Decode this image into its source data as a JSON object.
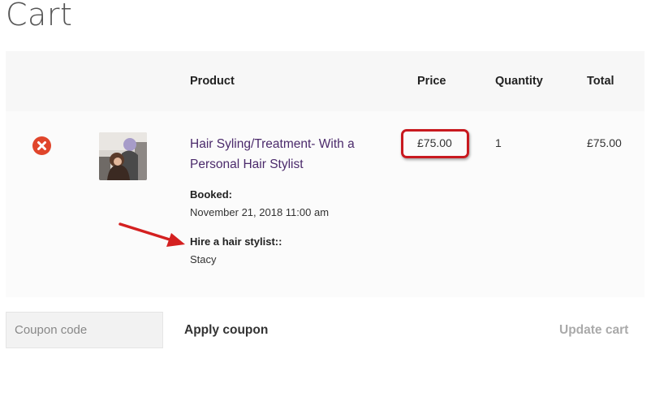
{
  "page": {
    "title": "Cart"
  },
  "table": {
    "headers": {
      "product": "Product",
      "price": "Price",
      "quantity": "Quantity",
      "total": "Total"
    },
    "rows": [
      {
        "product_name": "Hair Syling/Treatment- With a Personal Hair Stylist",
        "booked_label": "Booked:",
        "booked_value": "November 21, 2018 11:00 am",
        "stylist_label": "Hire a hair stylist::",
        "stylist_value": "Stacy",
        "price": "£75.00",
        "quantity": "1",
        "total": "£75.00",
        "remove_icon": "close-icon"
      }
    ]
  },
  "coupon": {
    "placeholder": "Coupon code",
    "apply_label": "Apply coupon"
  },
  "actions": {
    "update_label": "Update cart"
  },
  "colors": {
    "remove": "#e0452b",
    "highlight": "#c8191f",
    "link": "#4b2a6b",
    "arrow": "#d42020"
  }
}
